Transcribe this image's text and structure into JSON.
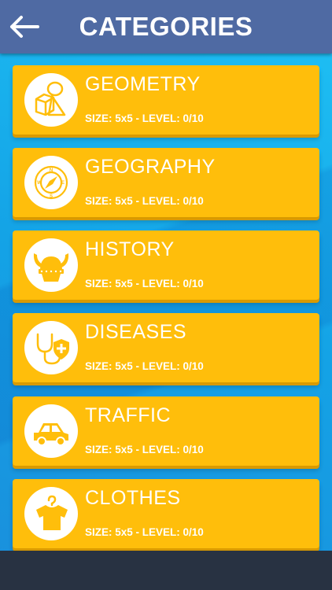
{
  "colors": {
    "header_bg": "#4f6aa3",
    "card_bg": "#ffbe0b",
    "icon_fg": "#ffbe0b",
    "background": "#15a9e6",
    "bottom_bar": "#283242"
  },
  "header": {
    "title": "CATEGORIES",
    "back_icon": "arrow-left-icon"
  },
  "categories": [
    {
      "name": "GEOMETRY",
      "meta": "SIZE: 5x5 - LEVEL: 0/10",
      "icon": "geometry-shapes-icon"
    },
    {
      "name": "GEOGRAPHY",
      "meta": "SIZE: 5x5 - LEVEL: 0/10",
      "icon": "compass-icon"
    },
    {
      "name": "HISTORY",
      "meta": "SIZE: 5x5 - LEVEL: 0/10",
      "icon": "viking-helmet-icon"
    },
    {
      "name": "DISEASES",
      "meta": "SIZE: 5x5 - LEVEL: 0/10",
      "icon": "stethoscope-shield-icon"
    },
    {
      "name": "TRAFFIC",
      "meta": "SIZE: 5x5 - LEVEL: 0/10",
      "icon": "car-icon"
    },
    {
      "name": "CLOTHES",
      "meta": "SIZE: 5x5 - LEVEL: 0/10",
      "icon": "shirt-hanger-icon"
    }
  ]
}
